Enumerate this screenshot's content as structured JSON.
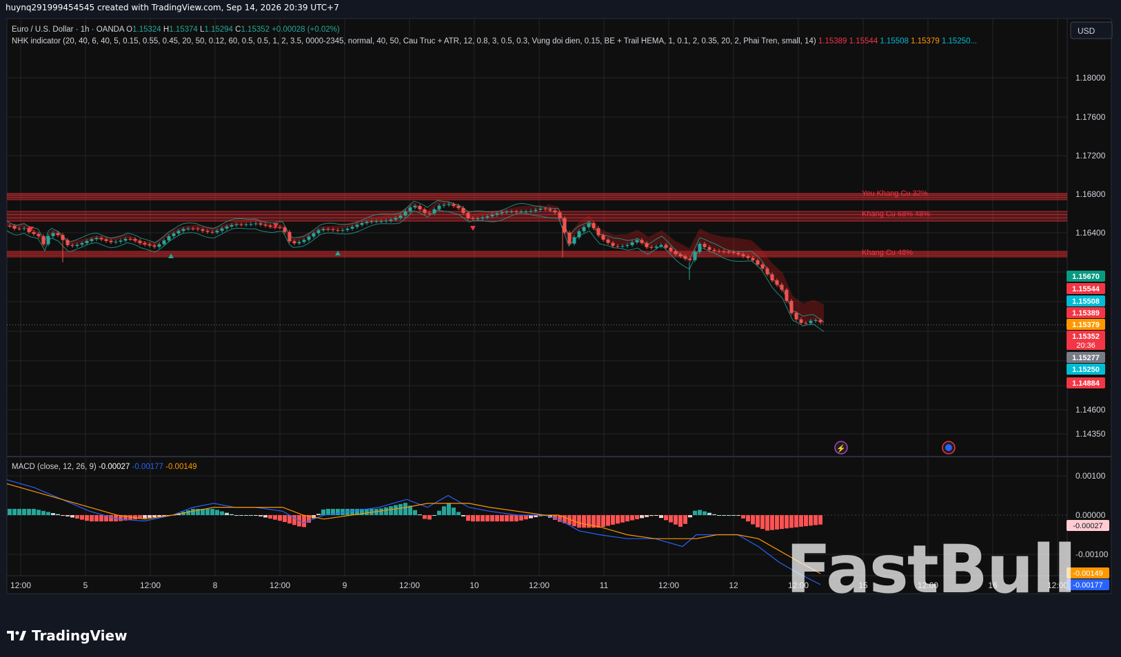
{
  "header": {
    "byline": "huynq291999454545 created with TradingView.com, Sep 14, 2026 20:39 UTC+7"
  },
  "currency_button": "USD",
  "footer_brand": "TradingView",
  "watermark": "FastBull",
  "legend": {
    "symbol": "Euro / U.S. Dollar · 1h · OANDA",
    "ohlc": [
      {
        "k": "O",
        "v": "1.15324"
      },
      {
        "k": "H",
        "v": "1.15374"
      },
      {
        "k": "L",
        "v": "1.15294"
      },
      {
        "k": "C",
        "v": "1.15352"
      }
    ],
    "change": "+0.00028 (+0.02%)",
    "indicator": "NHK indicator (20, 40, 6, 40, 5, 0.15, 0.55, 0.45, 20, 50, 0.12, 60, 0.5, 0.5, 1, 2, 3.5, 0000-2345, normal, 40, 50, Cau Truc + ATR, 12, 0.8, 3, 0.5, 0.3, Vung doi dien, 0.15, BE + Trail HEMA, 1, 0.1, 2, 0.35, 20, 2, Phai Tren, small, 14)",
    "indicator_values": [
      {
        "v": "1.15389",
        "c": "#f23645"
      },
      {
        "v": "1.15544",
        "c": "#f23645"
      },
      {
        "v": "1.15508",
        "c": "#00bcd4"
      },
      {
        "v": "1.15379",
        "c": "#ff9800"
      },
      {
        "v": "1.15250...",
        "c": "#00bcd4"
      }
    ],
    "macd_title": "MACD (close, 12, 26, 9)",
    "macd_values": [
      {
        "v": "-0.00027",
        "c": "#ffffff"
      },
      {
        "v": "-0.00177",
        "c": "#2962ff"
      },
      {
        "v": "-0.00149",
        "c": "#ff9800"
      }
    ]
  },
  "chart_data": {
    "type": "candlestick",
    "title": "Euro / U.S. Dollar · 1h · OANDA",
    "x_ticks": [
      "12:00",
      "5",
      "12:00",
      "8",
      "12:00",
      "9",
      "12:00",
      "10",
      "12:00",
      "11",
      "12:00",
      "12",
      "12:00",
      "15",
      "12:00",
      "16",
      "12:00"
    ],
    "y_ticks": [
      "1.18000",
      "1.17600",
      "1.17200",
      "1.16800",
      "1.16400",
      "1.14600",
      "1.14350"
    ],
    "price_labels": [
      {
        "text": "1.15670",
        "bg": "#089981",
        "price": 1.1567
      },
      {
        "text": "1.15544",
        "bg": "#f23645",
        "price": 1.15544
      },
      {
        "text": "1.15508",
        "bg": "#00bcd4",
        "price": 1.15508
      },
      {
        "text": "1.15389",
        "bg": "#f23645",
        "price": 1.15389
      },
      {
        "text": "1.15379",
        "bg": "#ff9800",
        "price": 1.15379
      },
      {
        "text": "1.15352",
        "sub": "20:36",
        "bg": "#f23645",
        "price": 1.15352
      },
      {
        "text": "1.15277",
        "bg": "#787b86",
        "price": 1.15277
      },
      {
        "text": "1.15250",
        "bg": "#00bcd4",
        "price": 1.1525
      },
      {
        "text": "1.14884",
        "bg": "#f23645",
        "price": 1.14884
      }
    ],
    "zones": [
      {
        "label": "Yeu Khang Cu 32%",
        "top": 1.1682,
        "bottom": 1.1675
      },
      {
        "label": "Khang Cu 68% 48%",
        "top": 1.1662,
        "bottom": 1.1652
      },
      {
        "label": "Khang Cu 48%",
        "top": 1.163,
        "bottom": 1.1625
      }
    ],
    "close_path": [
      [
        0,
        1.1638
      ],
      [
        12,
        1.1635
      ],
      [
        25,
        1.1637
      ],
      [
        33,
        1.1632
      ],
      [
        45,
        1.1628
      ],
      [
        55,
        1.1615
      ],
      [
        62,
        1.163
      ],
      [
        75,
        1.1628
      ],
      [
        90,
        1.1618
      ],
      [
        110,
        1.162
      ],
      [
        130,
        1.1624
      ],
      [
        150,
        1.1622
      ],
      [
        175,
        1.1625
      ],
      [
        195,
        1.1618
      ],
      [
        215,
        1.1617
      ],
      [
        235,
        1.1628
      ],
      [
        255,
        1.1633
      ],
      [
        275,
        1.1635
      ],
      [
        300,
        1.1632
      ],
      [
        330,
        1.1638
      ],
      [
        360,
        1.1642
      ],
      [
        385,
        1.1635
      ],
      [
        400,
        1.1635
      ],
      [
        412,
        1.162
      ],
      [
        430,
        1.1624
      ],
      [
        455,
        1.1633
      ],
      [
        480,
        1.1634
      ],
      [
        505,
        1.1638
      ],
      [
        540,
        1.1643
      ],
      [
        570,
        1.1648
      ],
      [
        590,
        1.1658
      ],
      [
        610,
        1.165
      ],
      [
        625,
        1.166
      ],
      [
        640,
        1.166
      ],
      [
        655,
        1.1655
      ],
      [
        670,
        1.1645
      ],
      [
        690,
        1.1648
      ],
      [
        715,
        1.165
      ],
      [
        745,
        1.1654
      ],
      [
        775,
        1.1655
      ],
      [
        800,
        1.165
      ],
      [
        815,
        1.162
      ],
      [
        828,
        1.1632
      ],
      [
        845,
        1.164
      ],
      [
        860,
        1.1625
      ],
      [
        880,
        1.1618
      ],
      [
        900,
        1.1618
      ],
      [
        915,
        1.1622
      ],
      [
        930,
        1.1614
      ],
      [
        950,
        1.162
      ],
      [
        970,
        1.1608
      ],
      [
        990,
        1.16
      ],
      [
        1005,
        1.162
      ],
      [
        1020,
        1.1614
      ],
      [
        1040,
        1.161
      ],
      [
        1060,
        1.1608
      ],
      [
        1080,
        1.1605
      ],
      [
        1095,
        1.1595
      ],
      [
        1110,
        1.158
      ],
      [
        1125,
        1.157
      ],
      [
        1140,
        1.1545
      ],
      [
        1155,
        1.1537
      ],
      [
        1170,
        1.154
      ],
      [
        1185,
        1.1535
      ]
    ],
    "macd_ticks": [
      "0.00100",
      "0.00000",
      "-0.00100"
    ],
    "macd_labels": [
      {
        "text": "-0.00027",
        "bg": "#ffcdd2",
        "fg": "#131722",
        "value": -0.00027
      },
      {
        "text": "-0.00149",
        "bg": "#ff9800",
        "fg": "#ffffff",
        "value": -0.00149
      },
      {
        "text": "-0.00177",
        "bg": "#2962ff",
        "fg": "#ffffff",
        "value": -0.00177
      }
    ],
    "macd_line": [
      [
        0,
        0.0009
      ],
      [
        40,
        0.0007
      ],
      [
        80,
        0.0004
      ],
      [
        120,
        0.0001
      ],
      [
        160,
        -0.0001
      ],
      [
        200,
        -0.00015
      ],
      [
        240,
        0.0
      ],
      [
        270,
        0.0002
      ],
      [
        300,
        0.0003
      ],
      [
        330,
        0.0002
      ],
      [
        360,
        0.0002
      ],
      [
        400,
        0.0001
      ],
      [
        430,
        -0.0002
      ],
      [
        460,
        0.0
      ],
      [
        500,
        0.0001
      ],
      [
        540,
        0.0002
      ],
      [
        580,
        0.0004
      ],
      [
        610,
        0.0002
      ],
      [
        640,
        0.0005
      ],
      [
        670,
        0.0002
      ],
      [
        700,
        0.0001
      ],
      [
        740,
        0.0
      ],
      [
        780,
        0.0
      ],
      [
        800,
        -0.0001
      ],
      [
        830,
        -0.0004
      ],
      [
        860,
        -0.0005
      ],
      [
        900,
        -0.0006
      ],
      [
        940,
        -0.0006
      ],
      [
        980,
        -0.0008
      ],
      [
        1000,
        -0.0005
      ],
      [
        1030,
        -0.0005
      ],
      [
        1060,
        -0.0005
      ],
      [
        1090,
        -0.0008
      ],
      [
        1120,
        -0.0012
      ],
      [
        1150,
        -0.0015
      ],
      [
        1180,
        -0.00177
      ]
    ],
    "signal_line": [
      [
        0,
        0.0008
      ],
      [
        40,
        0.0006
      ],
      [
        80,
        0.0004
      ],
      [
        120,
        0.0002
      ],
      [
        160,
        0.0
      ],
      [
        200,
        -0.0001
      ],
      [
        240,
        0.0
      ],
      [
        270,
        0.0001
      ],
      [
        300,
        0.0002
      ],
      [
        330,
        0.0002
      ],
      [
        360,
        0.0002
      ],
      [
        400,
        0.0002
      ],
      [
        430,
        0.0
      ],
      [
        460,
        -0.0001
      ],
      [
        500,
        0.0
      ],
      [
        540,
        0.0001
      ],
      [
        580,
        0.0002
      ],
      [
        610,
        0.0003
      ],
      [
        640,
        0.0003
      ],
      [
        670,
        0.0003
      ],
      [
        700,
        0.0002
      ],
      [
        740,
        0.0001
      ],
      [
        780,
        0.0
      ],
      [
        800,
        0.0
      ],
      [
        830,
        -0.0002
      ],
      [
        860,
        -0.0003
      ],
      [
        900,
        -0.0005
      ],
      [
        940,
        -0.0006
      ],
      [
        980,
        -0.0006
      ],
      [
        1000,
        -0.0006
      ],
      [
        1030,
        -0.0005
      ],
      [
        1060,
        -0.0005
      ],
      [
        1090,
        -0.0006
      ],
      [
        1120,
        -0.0009
      ],
      [
        1150,
        -0.0012
      ],
      [
        1180,
        -0.00149
      ]
    ]
  }
}
